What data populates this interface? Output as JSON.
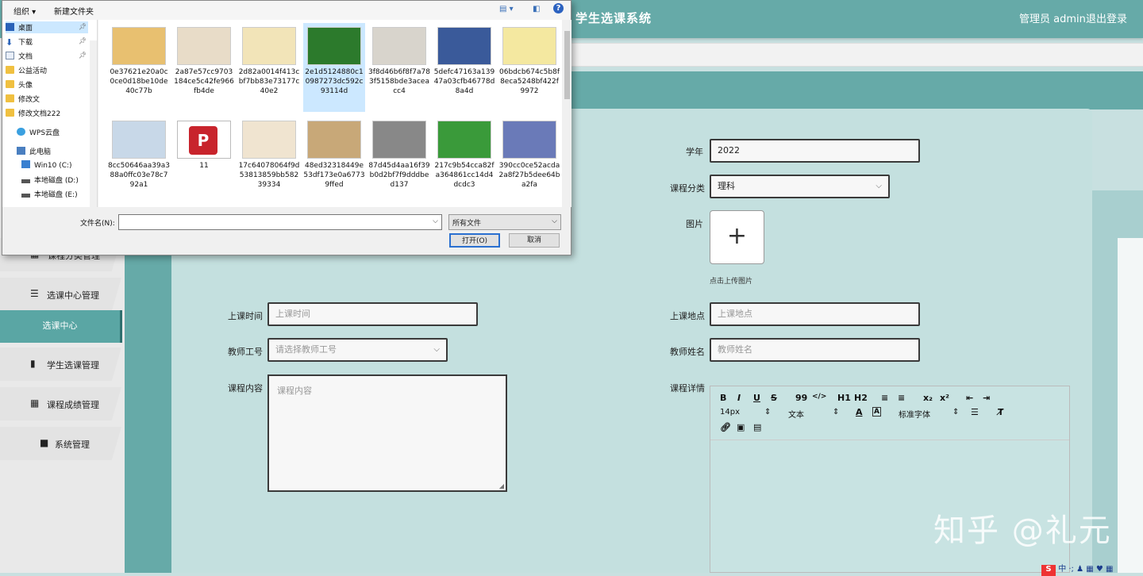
{
  "app": {
    "title": "学生选课系统",
    "admin_label": "管理员 admin",
    "logout": "退出登录"
  },
  "menu": [
    {
      "label": "课程分类管理"
    },
    {
      "label": "选课中心管理"
    },
    {
      "label": "选课中心",
      "active": true
    },
    {
      "label": "学生选课管理"
    },
    {
      "label": "课程成绩管理"
    },
    {
      "label": "系统管理"
    }
  ],
  "form": {
    "year": {
      "label": "学年",
      "value": "2022"
    },
    "category": {
      "label": "课程分类",
      "value": "理科"
    },
    "image": {
      "label": "图片",
      "upload_tip": "点击上传图片"
    },
    "time": {
      "label": "上课时间",
      "placeholder": "上课时间"
    },
    "place": {
      "label": "上课地点",
      "placeholder": "上课地点"
    },
    "teacher_id": {
      "label": "教师工号",
      "placeholder": "请选择教师工号"
    },
    "teacher_name": {
      "label": "教师姓名",
      "placeholder": "教师姓名"
    },
    "content": {
      "label": "课程内容",
      "placeholder": "课程内容"
    },
    "detail": {
      "label": "课程详情"
    }
  },
  "editor": {
    "buttons": [
      "B",
      "I",
      "U",
      "S",
      "99",
      "</>",
      "H1",
      "H2",
      "≡",
      "≡",
      "x₂",
      "x²",
      "⇤",
      "⇥"
    ],
    "font_size": "14px",
    "block": "文本",
    "font_family": "标准字体"
  },
  "watermark": "知乎 @礼元",
  "dialog": {
    "toolbar": {
      "organize": "组织 ▾",
      "new_folder": "新建文件夹"
    },
    "nav": [
      {
        "label": "桌面",
        "icon": "desktop-icon"
      },
      {
        "label": "下载",
        "icon": "download-icon"
      },
      {
        "label": "文档",
        "icon": "document-icon"
      },
      {
        "label": "公益活动",
        "icon": "folder-icon"
      },
      {
        "label": "头像",
        "icon": "folder-icon"
      },
      {
        "label": "修改文",
        "icon": "folder-icon"
      },
      {
        "label": "修改文档222",
        "icon": "folder-icon"
      },
      {
        "label": "WPS云盘",
        "icon": "cloud-icon"
      },
      {
        "label": "此电脑",
        "icon": "computer-icon"
      },
      {
        "label": "Win10 (C:)",
        "icon": "disk-icon"
      },
      {
        "label": "本地磁盘 (D:)",
        "icon": "disk-icon"
      },
      {
        "label": "本地磁盘 (E:)",
        "icon": "disk-icon"
      }
    ],
    "files": [
      {
        "name": "0e37621e20a0c0ce0d18be10de40c77b",
        "color": "#e8c070"
      },
      {
        "name": "2a87e57cc9703184ce5c42fe966fb4de",
        "color": "#e8dcc8"
      },
      {
        "name": "2d82a0014f413cbf7bb83e73177c40e2",
        "color": "#f2e4b8"
      },
      {
        "name": "2e1d5124880c10987273dc592c93114d",
        "color": "#2c7a2c",
        "selected": true
      },
      {
        "name": "3f8d46b6f8f7a783f5158bde3aceacc4",
        "color": "#d8d4cc"
      },
      {
        "name": "5defc47163a13947a03cfb46778d8a4d",
        "color": "#3a5a9a"
      },
      {
        "name": "06bdcb674c5b8f8eca5248bf422f9972",
        "color": "#f4e8a0"
      },
      {
        "name": "8cc50646aa39a388a0ffc03e78c792a1",
        "color": "#c8d8e8"
      },
      {
        "name": "11",
        "color": "#ffffff",
        "pdf": true
      },
      {
        "name": "17c64078064f9d53813859bb58239334",
        "color": "#f0e4d0"
      },
      {
        "name": "48ed32318449e53df173e0a67739ffed",
        "color": "#c8a878"
      },
      {
        "name": "87d45d4aa16f39b0d2bf7f9dddbed137",
        "color": "#888888"
      },
      {
        "name": "217c9b54cca82fa364861cc14d4dcdc3",
        "color": "#3a9a3a"
      },
      {
        "name": "390cc0ce52acda2a8f27b5dee64ba2fa",
        "color": "#6a7ab8"
      }
    ],
    "filename_label": "文件名(N):",
    "filetype": "所有文件",
    "open": "打开(O)",
    "cancel": "取消"
  }
}
